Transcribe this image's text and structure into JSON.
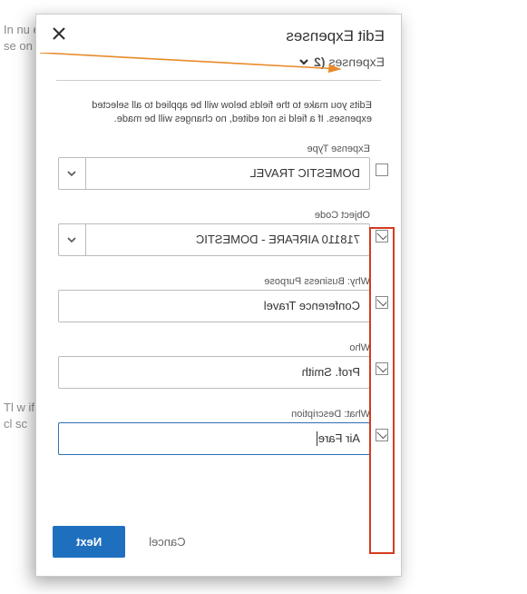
{
  "header": {
    "title": "Edit Expenses",
    "subhead_prefix": "Expenses",
    "count": "(2"
  },
  "info": "Edits you make to the fields below will be applied to all selected expenses. If a field is not edited, no changes will be made.",
  "fields": {
    "expense_type": {
      "label": "Expense Type",
      "value": "DOMESTIC TRAVEL"
    },
    "object_code": {
      "label": "Object Code",
      "value": "718110 AIRFARE - DOMESTIC"
    },
    "why": {
      "label": "Why: Business Purpose",
      "value": "Conference Travel"
    },
    "who": {
      "label": "Who",
      "value": "Prof. Smith"
    },
    "what": {
      "label": "What: Description",
      "value": "Air Fare"
    }
  },
  "footer": {
    "cancel": "Cancel",
    "next": "Next"
  },
  "side_text": {
    "top": "In\nnu\nex\nse\non\nsc",
    "bottom": "Tl\nw\nif\nm\ncl\nsc"
  }
}
